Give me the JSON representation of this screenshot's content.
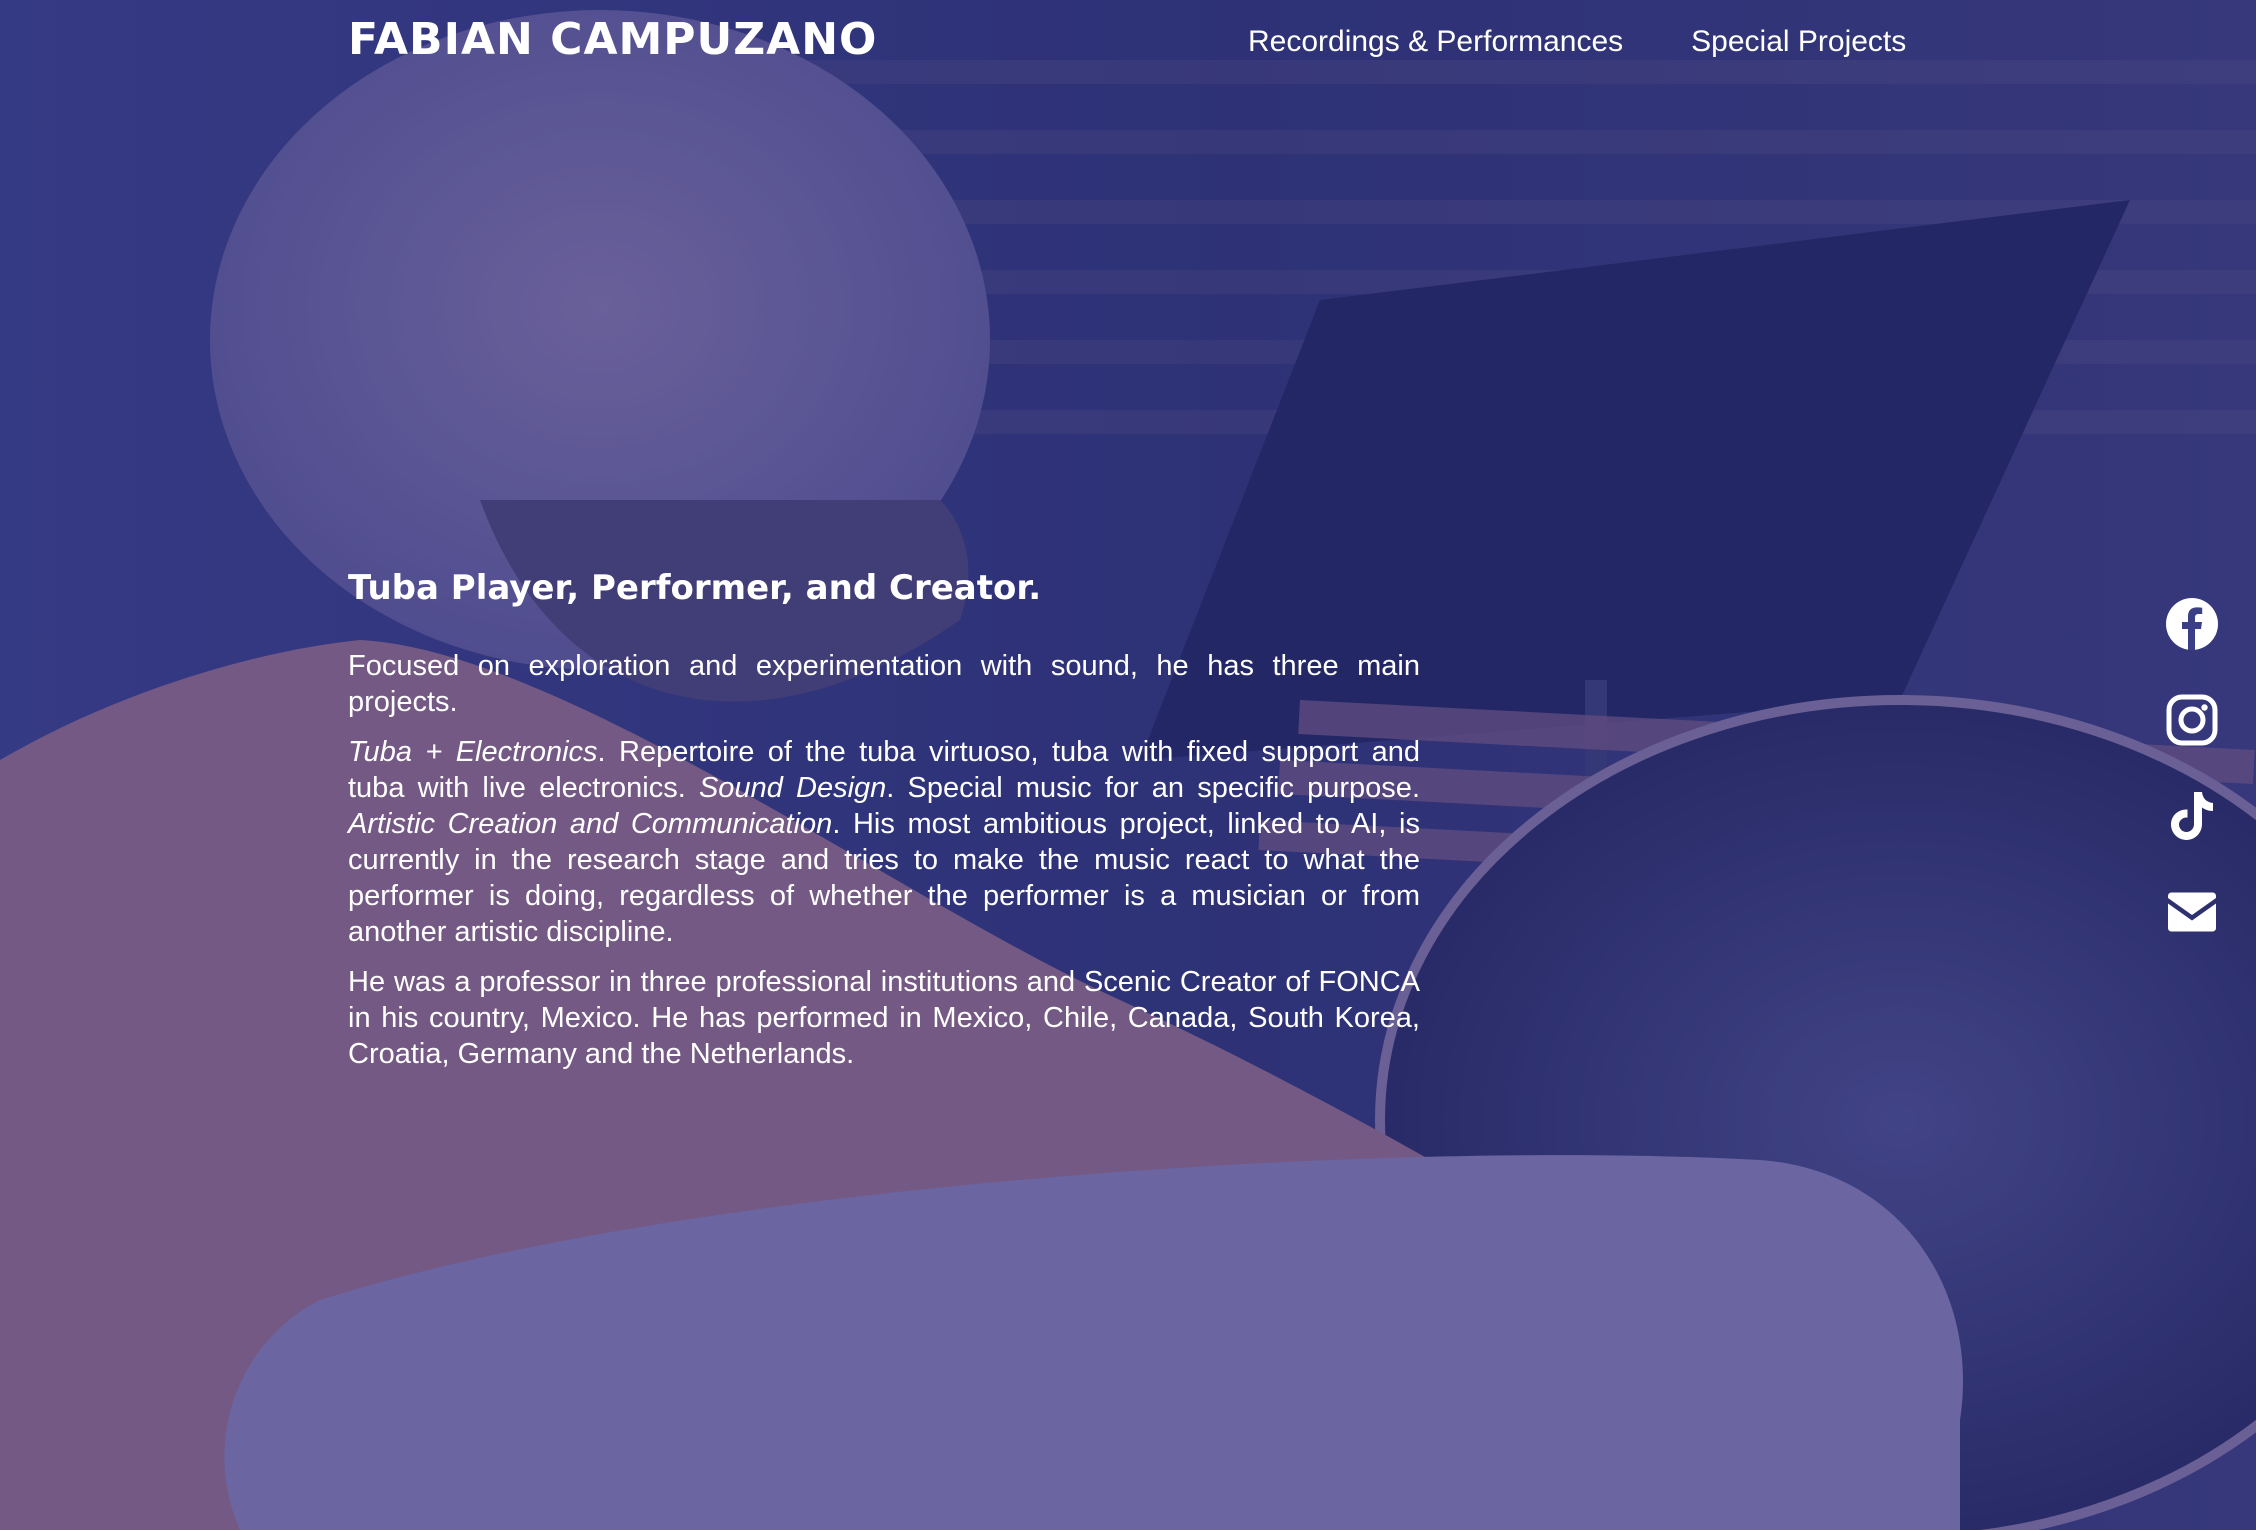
{
  "header": {
    "brand": "FABIAN CAMPUZANO",
    "nav": [
      {
        "label": "Recordings & Performances"
      },
      {
        "label": "Special Projects"
      }
    ]
  },
  "main": {
    "headline": "Tuba Player, Performer, and Creator.",
    "intro": "Focused on exploration and experimentation with sound, he has three main projects.",
    "projects": {
      "p1_title": "Tuba + Electronics",
      "p1_text": ". Repertoire of the tuba virtuoso, tuba with fixed support and tuba with live electronics. ",
      "p2_title": "Sound Design",
      "p2_text": ". Special music for an specific purpose. ",
      "p3_title": "Artistic Creation and Communication",
      "p3_text": ". His most ambitious project, linked to AI, is currently in the research stage and tries to make the music react to what the performer is doing, regardless of whether the performer is a musician or from another artistic discipline."
    },
    "bio": "He was a professor in three professional institutions and Scenic Creator of FONCA in his country, Mexico. He has performed in Mexico, Chile, Canada, South Korea, Croatia, Germany and the Netherlands."
  },
  "social": [
    {
      "icon": "facebook-icon"
    },
    {
      "icon": "instagram-icon"
    },
    {
      "icon": "tiktok-icon"
    },
    {
      "icon": "envelope-icon"
    }
  ],
  "colors": {
    "overlay": "#2d3282",
    "text": "#ffffff",
    "shirt": "#b87a6e"
  }
}
